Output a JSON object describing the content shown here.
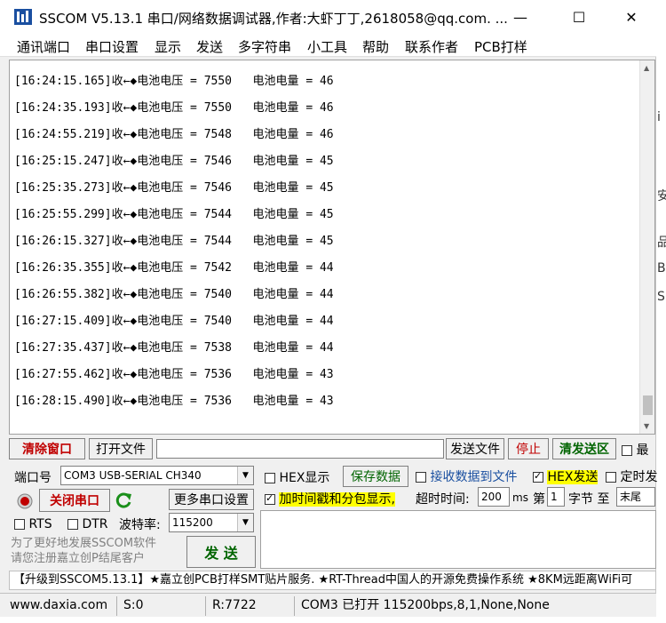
{
  "window": {
    "title": "SSCOM V5.13.1 串口/网络数据调试器,作者:大虾丁丁,2618058@qq.com. ...",
    "minimize": "—",
    "maximize": "☐",
    "close": "✕"
  },
  "menu": [
    "通讯端口",
    "串口设置",
    "显示",
    "发送",
    "多字符串",
    "小工具",
    "帮助",
    "联系作者",
    "PCB打样"
  ],
  "receive": {
    "lines": [
      "[16:24:15.165]收←◆电池电压 = 7550   电池电量 = 46",
      "[16:24:35.193]收←◆电池电压 = 7550   电池电量 = 46",
      "[16:24:55.219]收←◆电池电压 = 7548   电池电量 = 46",
      "[16:25:15.247]收←◆电池电压 = 7546   电池电量 = 45",
      "[16:25:35.273]收←◆电池电压 = 7546   电池电量 = 45",
      "[16:25:55.299]收←◆电池电压 = 7544   电池电量 = 45",
      "[16:26:15.327]收←◆电池电压 = 7544   电池电量 = 45",
      "[16:26:35.355]收←◆电池电压 = 7542   电池电量 = 44",
      "[16:26:55.382]收←◆电池电压 = 7540   电池电量 = 44",
      "[16:27:15.409]收←◆电池电压 = 7540   电池电量 = 44",
      "[16:27:35.437]收←◆电池电压 = 7538   电池电量 = 44",
      "[16:27:55.462]收←◆电池电压 = 7536   电池电量 = 43",
      "[16:28:15.490]收←◆电池电压 = 7536   电池电量 = 43"
    ]
  },
  "toolbar": {
    "clear_window": "清除窗口",
    "open_file": "打开文件",
    "file_path": "",
    "send_file": "发送文件",
    "stop": "停止",
    "clear_send": "清发送区",
    "most_front": "最"
  },
  "port": {
    "port_label": "端口号",
    "port_value": "COM3 USB-SERIAL CH340",
    "close_port": "关闭串口",
    "more_settings": "更多串口设置",
    "rts": "RTS",
    "dtr": "DTR",
    "baud_label": "波特率:",
    "baud_value": "115200"
  },
  "options": {
    "hex_display": "HEX显示",
    "save_data": "保存数据",
    "recv_to_file": "接收数据到文件",
    "hex_send": "HEX发送",
    "timed": "定时发",
    "timestamp": "加时间戳和分包显示,",
    "timeout_label": "超时时间:",
    "timeout_value": "200",
    "ms": "ms",
    "di": "第",
    "byte_index": "1",
    "byte_to": "字节 至",
    "end_value": "末尾"
  },
  "send": {
    "promo_text": "为了更好地发展SSCOM软件\n请您注册嘉立创P结尾客户",
    "send_button": "发 送",
    "send_text": ""
  },
  "ticker": "【升级到SSCOM5.13.1】★嘉立创PCB打样SMT贴片服务. ★RT-Thread中国人的开源免费操作系统 ★8KM远距离WiFi可",
  "status": {
    "website": "www.daxia.com",
    "sent": "S:0",
    "received": "R:7722",
    "port_state": "COM3 已打开  115200bps,8,1,None,None"
  },
  "colors": {
    "red_button": "#c00000",
    "green_button": "#006400",
    "highlight_yellow": "#ffff00",
    "promo_link_color": "#808080"
  }
}
